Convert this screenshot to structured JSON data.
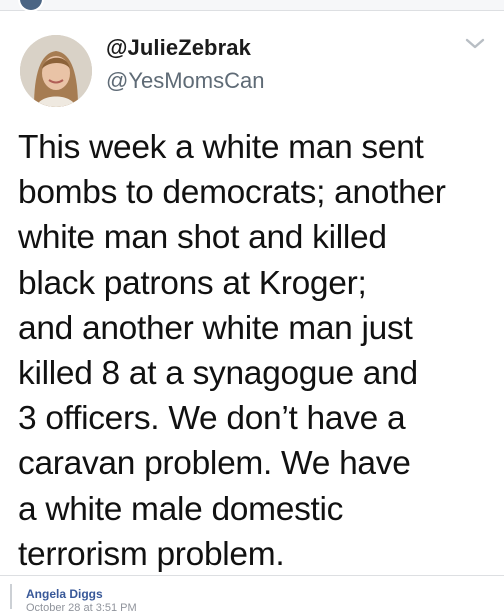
{
  "tweet": {
    "display_name": "@JulieZebrak",
    "handle": "@YesMomsCan",
    "text": "This week a white man sent\nbombs to democrats; another\nwhite man shot and killed\nblack patrons at Kroger;\nand another white man just\nkilled 8 at a synagogue and\n3 officers. We don’t have a\ncaravan problem. We have\na white male domestic\nterrorism problem.",
    "menu_icon": "chevron-down-icon"
  },
  "comment": {
    "author": "Angela Diggs",
    "timestamp": "October 28 at 3:51 PM"
  },
  "colors": {
    "link": "#385898",
    "meta": "#90949c",
    "text": "#111111",
    "handle": "#5f6b76"
  }
}
